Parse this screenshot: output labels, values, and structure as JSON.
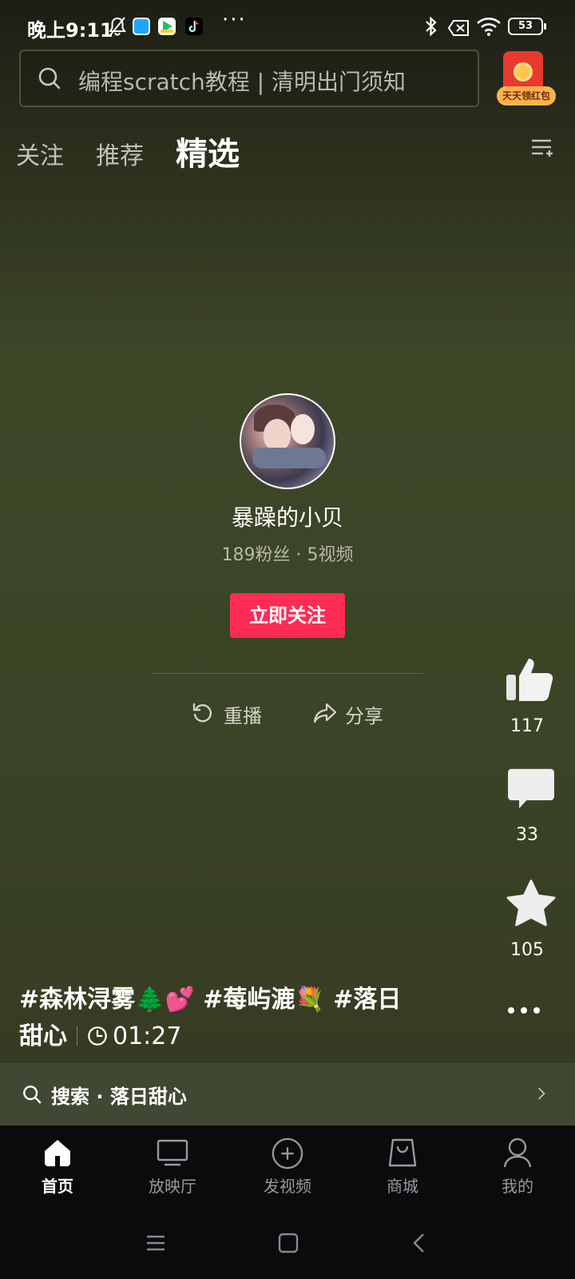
{
  "status_bar": {
    "time": "晚上9:11",
    "battery": "53"
  },
  "search": {
    "placeholder": "编程scratch教程 | 清明出门须知"
  },
  "red_packet": {
    "label": "天天领红包"
  },
  "tabs": [
    {
      "label": "关注",
      "active": false
    },
    {
      "label": "推荐",
      "active": false
    },
    {
      "label": "精选",
      "active": true
    }
  ],
  "profile": {
    "name": "暴躁的小贝",
    "stats": "189粉丝 · 5视频",
    "follow_label": "立即关注"
  },
  "actions": {
    "replay": "重播",
    "share": "分享"
  },
  "rail": {
    "likes": "117",
    "comments": "33",
    "favorites": "105"
  },
  "caption": {
    "text": "#森林浔雾🌲💕 #莓屿漉💐 #落日甜心",
    "duration": "01:27"
  },
  "related_search": {
    "text": "搜索 · 落日甜心"
  },
  "bottom_nav": [
    {
      "label": "首页",
      "icon": "home-icon",
      "active": true
    },
    {
      "label": "放映厅",
      "icon": "tv-icon",
      "active": false
    },
    {
      "label": "发视频",
      "icon": "plus-circle-icon",
      "active": false
    },
    {
      "label": "商城",
      "icon": "shopping-bag-icon",
      "active": false
    },
    {
      "label": "我的",
      "icon": "person-icon",
      "active": false
    }
  ],
  "colors": {
    "accent": "#fe2c55",
    "background": "#3a4126",
    "nav_background": "#0b0b0e"
  }
}
